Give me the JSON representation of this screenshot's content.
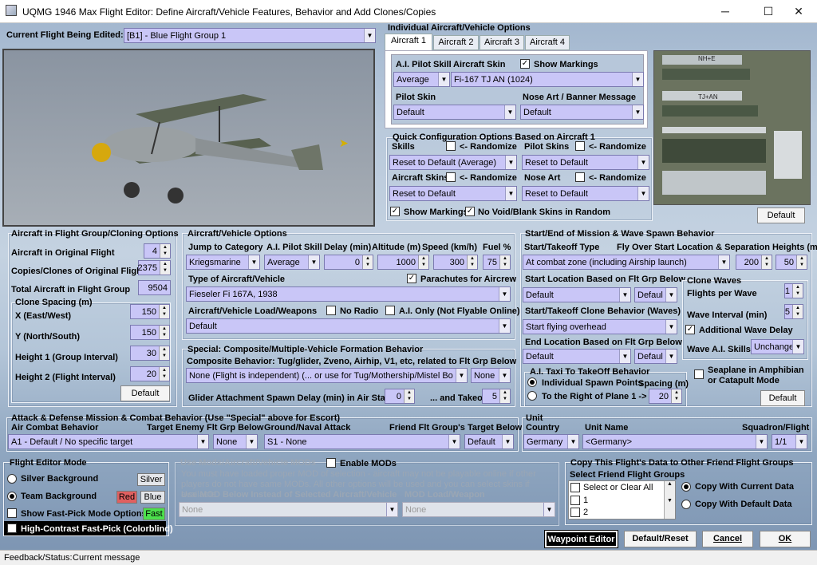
{
  "window": {
    "title": "UQMG 1946 Max Flight Editor:  Define Aircraft/Vehicle Features, Behavior and Add Clones/Copies",
    "minimize": "─",
    "maximize": "☐",
    "close": "✕"
  },
  "current_flight": {
    "label": "Current Flight Being Edited:",
    "value": "[B1] - Blue Flight Group  1"
  },
  "individual": {
    "title": "Individual Aircraft/Vehicle Options",
    "tabs": [
      "Aircraft 1",
      "Aircraft 2",
      "Aircraft 3",
      "Aircraft 4"
    ],
    "ai_pilot_skill_label": "A.I. Pilot Skill",
    "ai_pilot_skill": "Average",
    "aircraft_skin_label": "Aircraft Skin",
    "aircraft_skin": "Fi-167 TJ AN (1024)",
    "show_markings": "Show Markings",
    "pilot_skin_label": "Pilot Skin",
    "pilot_skin": "Default",
    "nose_art_label": "Nose Art / Banner Message",
    "nose_art": "Default",
    "default_btn": "Default"
  },
  "quick_config": {
    "title": "Quick Configuration Options Based on Aircraft 1",
    "skills_label": "Skills",
    "randomize": "<- Randomize",
    "skills_value": "Reset to Default (Average)",
    "pilot_skins_label": "Pilot Skins",
    "pilot_skins_value": "Reset to Default",
    "aircraft_skins_label": "Aircraft Skins",
    "aircraft_skins_value": "Reset to Default",
    "nose_art_label": "Nose Art",
    "nose_art_value": "Reset to Default",
    "show_markings": "Show Markings",
    "no_void": "No Void/Blank Skins in Random"
  },
  "cloning": {
    "title": "Aircraft in Flight Group/Cloning Options",
    "orig_label": "Aircraft in Original Flight",
    "orig_value": "4",
    "copies_label": "Copies/Clones of Original Flight",
    "copies_value": "2375",
    "total_label": "Total Aircraft in Flight Group",
    "total_value": "9504",
    "spacing_title": "Clone Spacing (m)",
    "x_label": "X (East/West)",
    "x_value": "150",
    "y_label": "Y (North/South)",
    "y_value": "150",
    "h1_label": "Height 1 (Group Interval)",
    "h1_value": "30",
    "h2_label": "Height 2 (Flight Interval)",
    "h2_value": "20",
    "default_btn": "Default"
  },
  "aircraft_options": {
    "title": "Aircraft/Vehicle Options",
    "jump_label": "Jump to Category",
    "jump_value": "Kriegsmarine",
    "skill_label": "A.I. Pilot Skill",
    "skill_value": "Average",
    "delay_label": "Delay (min)",
    "delay_value": "0",
    "altitude_label": "Altitude (m)",
    "altitude_value": "1000",
    "speed_label": "Speed (km/h)",
    "speed_value": "300",
    "fuel_label": "Fuel %",
    "fuel_value": "75",
    "type_label": "Type of Aircraft/Vehicle",
    "type_value": "Fieseler Fi 167A, 1938",
    "parachutes": "Parachutes for Aircrew",
    "load_label": "Aircraft/Vehicle Load/Weapons",
    "load_value": "Default",
    "no_radio": "No Radio",
    "ai_only": "A.I. Only (Not Flyable Online)"
  },
  "composite": {
    "title": "Special: Composite/Multiple-Vehicle Formation Behavior",
    "behavior_label": "Composite Behavior: Tug/glider, Zveno, Airhip, V1, etc, related to Flt Grp Below",
    "behavior_value": "None (Flight is independent) (... or use for Tug/Mothership/Mistel Bo",
    "related_value": "None",
    "glider_label": "Glider Attachment Spawn Delay (min) in Air Start",
    "glider_value": "0",
    "takeoff_label": "... and Takeoff",
    "takeoff_value": "5"
  },
  "startend": {
    "title": "Start/End of Mission & Wave Spawn Behavior",
    "start_type_label": "Start/Takeoff Type",
    "start_type_value": "At combat zone (including Airship launch)",
    "fly_over_label": "Fly Over Start Location & Separation Heights (m)",
    "height_a": "200",
    "height_b": "50",
    "start_loc_label": "Start Location Based on Flt Grp Below",
    "start_loc_value": "Default",
    "start_loc_value2": "Defaul",
    "clone_beh_label": "Start/Takeoff Clone Behavior (Waves)",
    "clone_beh_value": "Start flying overhead",
    "end_loc_label": "End Location Based on Flt Grp Below",
    "end_loc_value": "Default",
    "end_loc_value2": "Defaul",
    "clone_waves_title": "Clone Waves",
    "flights_per_wave_label": "Flights per Wave",
    "flights_per_wave": "1",
    "wave_interval_label": "Wave Interval (min)",
    "wave_interval": "5",
    "additional_delay": "Additional Wave Delay",
    "wave_ai_skills_label": "Wave A.I. Skills",
    "wave_ai_skills": "Unchange",
    "taxi_title": "A.I. Taxi To TakeOff Behavior",
    "taxi_opt1": "Individual Spawn Points",
    "spacing_label": "Spacing (m)",
    "taxi_opt2": "To the Right of Plane 1 ->",
    "spacing_value": "20",
    "seaplane": "Seaplane in Amphibian or Catapult Mode",
    "default_btn": "Default"
  },
  "attack": {
    "title": "Attack & Defense Mission & Combat Behavior (Use \"Special\" above for Escort)",
    "air_label": "Air Combat Behavior",
    "air_value": "A1 - Default / No specific target",
    "target_label": "Target Enemy Flt Grp Below",
    "target_value": "None",
    "ground_label": "Ground/Naval Attack",
    "ground_value": "S1 - None",
    "friend_label": "Friend Flt Group's Target Below",
    "friend_value": "Default"
  },
  "unit": {
    "title": "Unit",
    "country_label": "Country",
    "country_value": "Germany",
    "name_label": "Unit Name",
    "name_value": "<Germany>",
    "squadron_label": "Squadron/Flight",
    "squadron_value": "1/1"
  },
  "mode": {
    "title": "Flight Editor Mode",
    "silver_bg": "Silver Background",
    "silver_tag": "Silver",
    "team_bg": "Team Background",
    "red_tag": "Red",
    "blue_tag": "Blue",
    "fast_pick": "Show Fast-Pick Mode Options",
    "fast_tag": "Fast",
    "high_contrast": "High-Contrast Fast-Pick (Colorblind)"
  },
  "mods": {
    "title": "Use Mods/Aircraft/Vehicle MODs",
    "enable": "Enable MODs",
    "note": "You must have loaded proper MOD of selection - aircraft may not be playable online if other players do not have same MODs. All other options will be used and you can select skins if available.",
    "use_label": "Use MOD Below Instead of Selected Aircraft/Vehicle",
    "use_value": "None",
    "load_label": "MOD Load/Weapon",
    "load_value": "None"
  },
  "copy": {
    "title": "Copy This Flight's Data to Other Friend Flight Groups",
    "select_label": "Select Friend Flight Groups",
    "items": [
      "Select or Clear All",
      "1",
      "2"
    ],
    "with_current": "Copy With Current Data",
    "with_default": "Copy With Default Data"
  },
  "actions": {
    "waypoint": "Waypoint Editor",
    "reset": "Default/Reset",
    "cancel": "Cancel",
    "ok": "OK"
  },
  "status": {
    "label": "Feedback/Status:",
    "message": "Current message"
  },
  "colors": {
    "field": "#c9c6f7",
    "red_tag": "#e06060",
    "fast_tag": "#4ce04c",
    "silver_tag": "#e4e6ea"
  }
}
